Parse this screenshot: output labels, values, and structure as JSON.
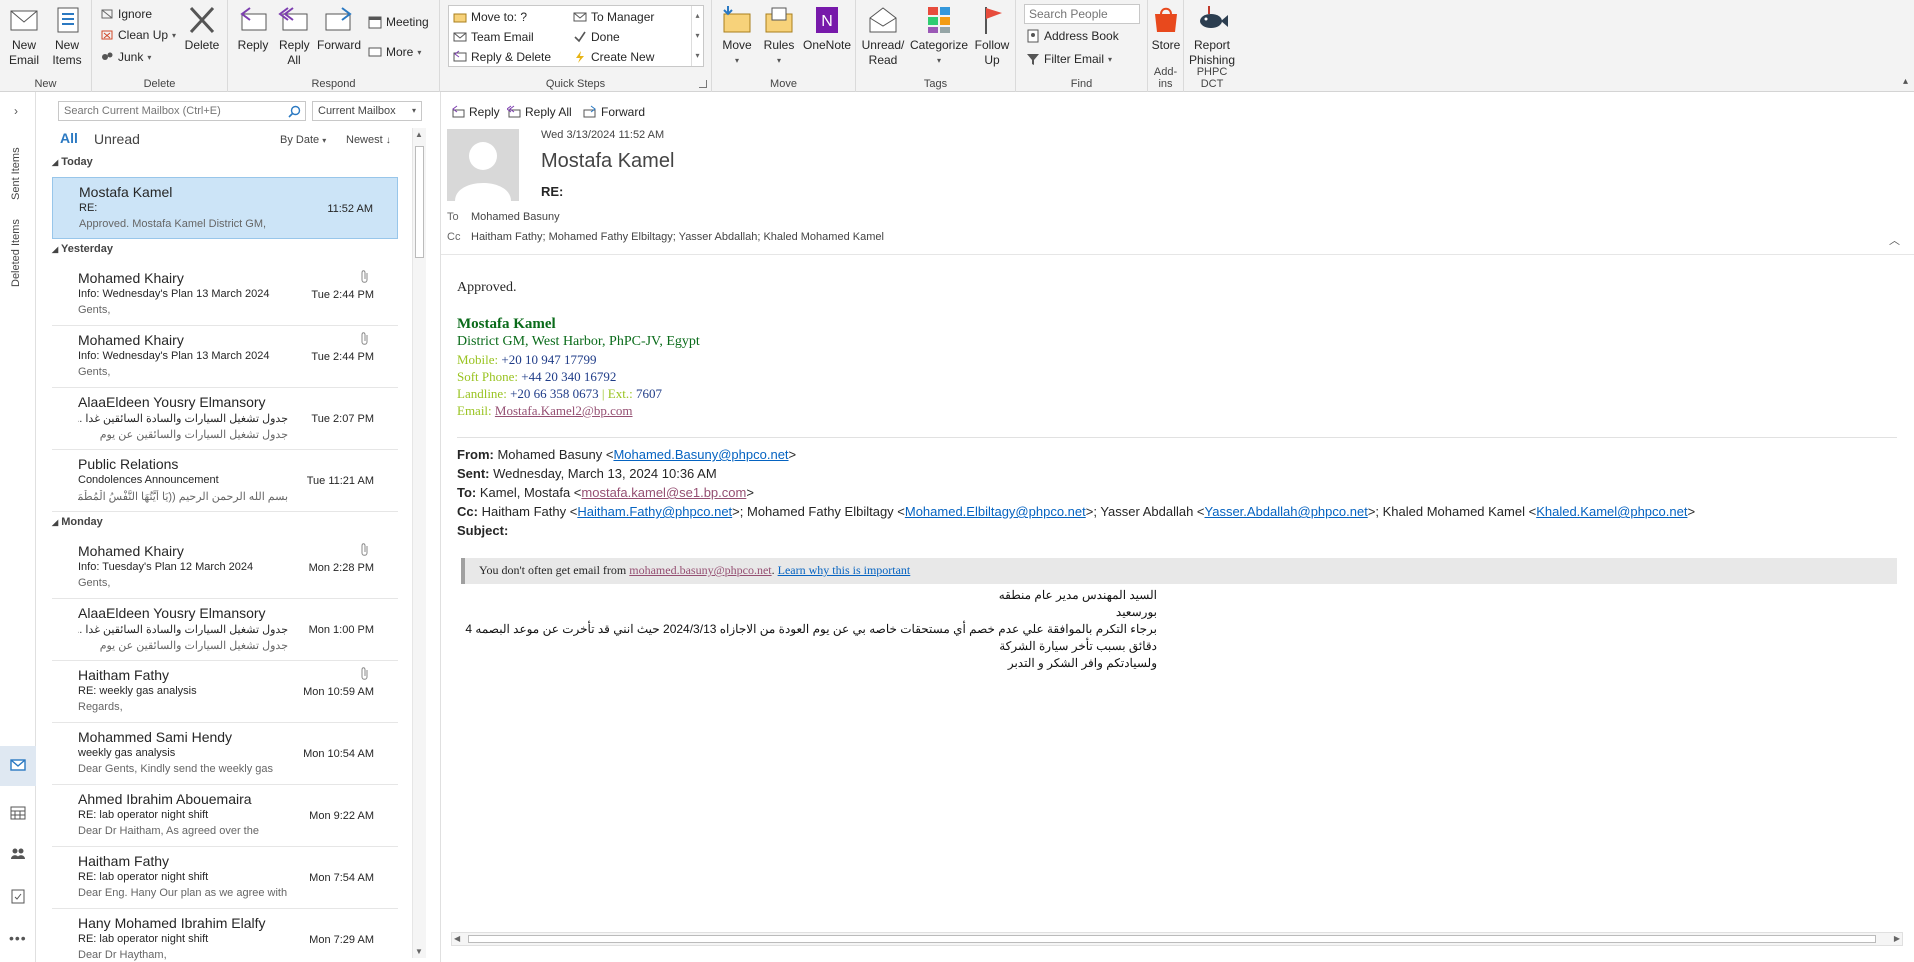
{
  "ribbon": {
    "new": {
      "label": "New",
      "new_email": "New Email",
      "new_items": "New Items"
    },
    "delete": {
      "label": "Delete",
      "ignore": "Ignore",
      "clean_up": "Clean Up",
      "junk": "Junk",
      "delete": "Delete"
    },
    "respond": {
      "label": "Respond",
      "reply": "Reply",
      "reply_all": "Reply All",
      "forward": "Forward",
      "meeting": "Meeting",
      "more": "More"
    },
    "quick_steps": {
      "label": "Quick Steps",
      "items": [
        "Move to: ?",
        "To Manager",
        "Team Email",
        "Done",
        "Reply & Delete",
        "Create New"
      ]
    },
    "move": {
      "label": "Move",
      "move": "Move",
      "rules": "Rules",
      "onenote": "OneNote"
    },
    "tags": {
      "label": "Tags",
      "unread_read": "Unread/ Read",
      "categorize": "Categorize",
      "follow_up": "Follow Up"
    },
    "find": {
      "label": "Find",
      "search_people": "Search People",
      "address_book": "Address Book",
      "filter_email": "Filter Email"
    },
    "addins": {
      "label": "Add-ins",
      "store": "Store"
    },
    "phpc": {
      "label": "PHPC DCT",
      "report": "Report Phishing"
    }
  },
  "nav": {
    "sent": "Sent Items",
    "deleted": "Deleted Items"
  },
  "list": {
    "search_placeholder": "Search Current Mailbox (Ctrl+E)",
    "scope": "Current Mailbox",
    "tab_all": "All",
    "tab_unread": "Unread",
    "sort_by": "By Date",
    "order": "Newest",
    "sections": {
      "today": "Today",
      "yesterday": "Yesterday",
      "monday": "Monday"
    },
    "items": [
      {
        "sender": "Mostafa Kamel",
        "subject": "RE:",
        "preview": "Approved.  Mostafa Kamel  District GM,",
        "time": "11:52 AM"
      },
      {
        "sender": "Mohamed Khairy",
        "subject": "Info: Wednesday's Plan 13 March 2024",
        "preview": "Gents,",
        "time": "Tue 2:44 PM"
      },
      {
        "sender": "Mohamed Khairy",
        "subject": "Info: Wednesday's Plan 13 March 2024",
        "preview": "Gents,",
        "time": "Tue 2:44 PM"
      },
      {
        "sender": "AlaaEldeen Yousry Elmansory",
        "subject": "جدول تشغيل السيارات والسادة السائقين غدا ...",
        "preview": "جدول تشغيل السيارات والسائقين عن يوم",
        "time": "Tue 2:07 PM"
      },
      {
        "sender": "Public Relations",
        "subject": "Condolences Announcement",
        "preview": "بسم الله الرحمن الرحيم  ((يَا أَيَّتُهَا النَّفْسُ الْمُطْمَئِنَّةُ",
        "time": "Tue 11:21 AM"
      },
      {
        "sender": "Mohamed Khairy",
        "subject": "Info: Tuesday's Plan 12 March 2024",
        "preview": "Gents,",
        "time": "Mon 2:28 PM"
      },
      {
        "sender": "AlaaEldeen Yousry Elmansory",
        "subject": "جدول تشغيل السيارات والسادة السائقين غدا ...",
        "preview": "جدول تشغيل السيارات والسائقين عن يوم",
        "time": "Mon 1:00 PM"
      },
      {
        "sender": "Haitham Fathy",
        "subject": "RE: weekly gas analysis",
        "preview": "Regards,",
        "time": "Mon 10:59 AM"
      },
      {
        "sender": "Mohammed Sami Hendy",
        "subject": "weekly gas analysis",
        "preview": "Dear Gents,  Kindly send the weekly gas",
        "time": "Mon 10:54 AM"
      },
      {
        "sender": "Ahmed Ibrahim Abouemaira",
        "subject": "RE: lab operator night shift",
        "preview": "Dear Dr Haitham,  As agreed over the",
        "time": "Mon 9:22 AM"
      },
      {
        "sender": "Haitham Fathy",
        "subject": "RE: lab operator night shift",
        "preview": "Dear Eng. Hany  Our plan as we agree with",
        "time": "Mon 7:54 AM"
      },
      {
        "sender": "Hany Mohamed Ibrahim Elalfy",
        "subject": "RE: lab operator night shift",
        "preview": "Dear Dr Haytham,",
        "time": "Mon 7:29 AM"
      }
    ]
  },
  "reading": {
    "actions": {
      "reply": "Reply",
      "reply_all": "Reply All",
      "forward": "Forward"
    },
    "date": "Wed 3/13/2024 11:52 AM",
    "sender": "Mostafa Kamel",
    "subject": "RE:",
    "to_label": "To",
    "to": "Mohamed Basuny",
    "cc_label": "Cc",
    "cc": "Haitham Fathy; Mohamed Fathy Elbiltagy; Yasser Abdallah; Khaled Mohamed Kamel",
    "body": {
      "approved": "Approved.",
      "sig_name": "Mostafa Kamel",
      "sig_title": "District GM, West Harbor, PhPC-JV, Egypt",
      "mobile_label": "Mobile:",
      "mobile": "+20 10 947 17799",
      "soft_label": "Soft Phone:",
      "soft": "+44 20 340 16792",
      "landline_label": "Landline:",
      "landline": "+20 66 358 0673",
      "ext_label": "| Ext.:",
      "ext": "7607",
      "email_label": "Email:",
      "email": "Mostafa.Kamel2@bp.com"
    },
    "orig": {
      "from_label": "From:",
      "from_name": "Mohamed Basuny <",
      "from_email": "Mohamed.Basuny@phpco.net",
      "sent_label": "Sent:",
      "sent": "Wednesday, March 13, 2024 10:36 AM",
      "to_label": "To:",
      "to_name": "Kamel, Mostafa <",
      "to_email": "mostafa.kamel@se1.bp.com",
      "cc_label": "Cc:",
      "cc1_name": "Haitham Fathy <",
      "cc1_email": "Haitham.Fathy@phpco.net",
      "cc2_name": ">; Mohamed Fathy Elbiltagy <",
      "cc2_email": "Mohamed.Elbiltagy@phpco.net",
      "cc3_name": ">; Yasser Abdallah <",
      "cc3_email": "Yasser.Abdallah@phpco.net",
      "cc4_name": ">; Khaled Mohamed Kamel <",
      "cc4_email": "Khaled.Kamel@phpco.net",
      "subject_label": "Subject:"
    },
    "notice": {
      "text": "You don't often get email from",
      "email": "mohamed.basuny@phpco.net",
      "learn": "Learn why this is important"
    },
    "arabic": [
      "السيد المهندس مدير عام منطقه بورسعيد",
      "برجاء التكرم بالموافقة علي عدم خصم أي مستحقات خاصه بي عن يوم العودة من الاجازاه 2024/3/13 حيث انني قد تأخرت عن موعد البصمه 4 دقائق بسبب تأخر سيارة الشركة",
      "ولسيادتكم وافر الشكر و التدبر"
    ]
  }
}
